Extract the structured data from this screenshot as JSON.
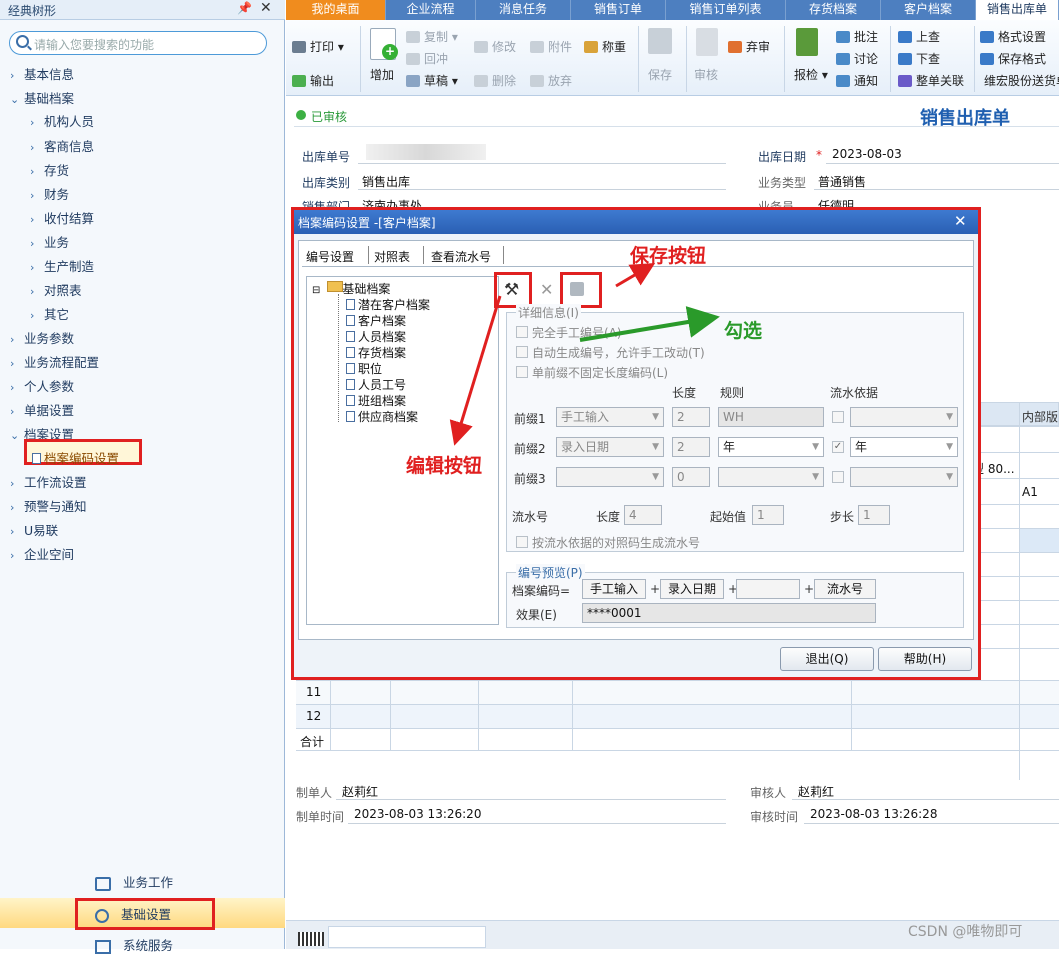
{
  "sidebar": {
    "title": "经典树形",
    "search_placeholder": "请输入您要搜索的功能",
    "items": [
      {
        "label": "基本信息",
        "arrow": "›"
      },
      {
        "label": "基础档案",
        "arrow": "⌄"
      },
      {
        "label": "机构人员",
        "arrow": "›"
      },
      {
        "label": "客商信息",
        "arrow": "›"
      },
      {
        "label": "存货",
        "arrow": "›"
      },
      {
        "label": "财务",
        "arrow": "›"
      },
      {
        "label": "收付结算",
        "arrow": "›"
      },
      {
        "label": "业务",
        "arrow": "›"
      },
      {
        "label": "生产制造",
        "arrow": "›"
      },
      {
        "label": "对照表",
        "arrow": "›"
      },
      {
        "label": "其它",
        "arrow": "›"
      },
      {
        "label": "业务参数",
        "arrow": "›"
      },
      {
        "label": "业务流程配置",
        "arrow": "›"
      },
      {
        "label": "个人参数",
        "arrow": "›"
      },
      {
        "label": "单据设置",
        "arrow": "›"
      },
      {
        "label": "档案设置",
        "arrow": "⌄"
      },
      {
        "label": "档案编码设置",
        "arrow": ""
      },
      {
        "label": "工作流设置",
        "arrow": "›"
      },
      {
        "label": "预警与通知",
        "arrow": "›"
      },
      {
        "label": "U易联",
        "arrow": "›"
      },
      {
        "label": "企业空间",
        "arrow": "›"
      }
    ],
    "bottom": [
      "业务工作",
      "基础设置",
      "系统服务"
    ]
  },
  "tabs": [
    "我的桌面",
    "企业流程",
    "消息任务",
    "销售订单",
    "销售订单列表",
    "存货档案",
    "客户档案",
    "销售出库单"
  ],
  "toolbar": {
    "print": "打印",
    "export": "输出",
    "add": "增加",
    "copy": "复制",
    "reverse": "回冲",
    "draft": "草稿",
    "modify": "修改",
    "delete": "删除",
    "attach": "附件",
    "discard": "放弃",
    "weigh": "称重",
    "save": "保存",
    "audit": "审核",
    "abandon": "弃审",
    "inspect": "报检",
    "batch_note": "批注",
    "discuss": "讨论",
    "notify": "通知",
    "prev": "上查",
    "next": "下查",
    "chain": "整单关联",
    "format_set": "格式设置",
    "save_format": "保存格式",
    "company": "维宏股份送货单"
  },
  "form": {
    "status": "已审核",
    "title": "销售出库单",
    "no_label": "出库单号",
    "date_label": "出库日期",
    "date_value": "2023-08-03",
    "type_label": "出库类别",
    "type_value": "销售出库",
    "biz_label": "业务类型",
    "biz_value": "普通销售",
    "dept_label": "销售部门",
    "dept_value": "济南办事处",
    "clerk_label": "业务员",
    "clerk_value": "任德明",
    "col_inner": "内部版",
    "cell_80": "型 80...",
    "cell_a1": "A1",
    "row11": "11",
    "row12": "12",
    "total": "合计",
    "maker_label": "制单人",
    "maker": "赵莉红",
    "make_time_label": "制单时间",
    "make_time": "2023-08-03 13:26:20",
    "auditor_label": "审核人",
    "auditor": "赵莉红",
    "audit_time_label": "审核时间",
    "audit_time": "2023-08-03 13:26:28"
  },
  "dialog": {
    "title": "档案编码设置 -[客户档案]",
    "tabs": [
      "编号设置",
      "对照表",
      "查看流水号"
    ],
    "tree_root": "基础档案",
    "tree_items": [
      "潜在客户档案",
      "客户档案",
      "人员档案",
      "存货档案",
      "职位",
      "人员工号",
      "班组档案",
      "供应商档案"
    ],
    "detail_title": "详细信息(I)",
    "chk_manual": "完全手工编号(A)",
    "chk_auto": "自动生成编号，允许手工改动(T)",
    "chk_prefix": "单前缀不固定长度编码(L)",
    "h_len": "长度",
    "h_rule": "规则",
    "h_basis": "流水依据",
    "p1": "前缀1",
    "p2": "前缀2",
    "p3": "前缀3",
    "p1_val": "手工输入",
    "p1_len": "2",
    "p1_rule": "WH",
    "p2_val": "录入日期",
    "p2_len": "2",
    "p2_rule": "年",
    "p2_basis": "年",
    "p3_len": "0",
    "serial": "流水号",
    "serial_len_label": "长度",
    "serial_len": "4",
    "start_label": "起始值",
    "start": "1",
    "step_label": "步长",
    "step": "1",
    "chk_serial": "按流水依据的对照码生成流水号",
    "preview_title": "编号预览(P)",
    "code_label": "档案编码=",
    "code_p1": "手工输入",
    "code_p2": "录入日期",
    "code_p3": "",
    "code_serial": "流水号",
    "effect_label": "效果(E)",
    "effect": "****0001",
    "exit": "退出(Q)",
    "help": "帮助(H)"
  },
  "annotations": {
    "save": "保存按钮",
    "check": "勾选",
    "edit": "编辑按钮"
  },
  "watermark": "CSDN @唯物即可"
}
